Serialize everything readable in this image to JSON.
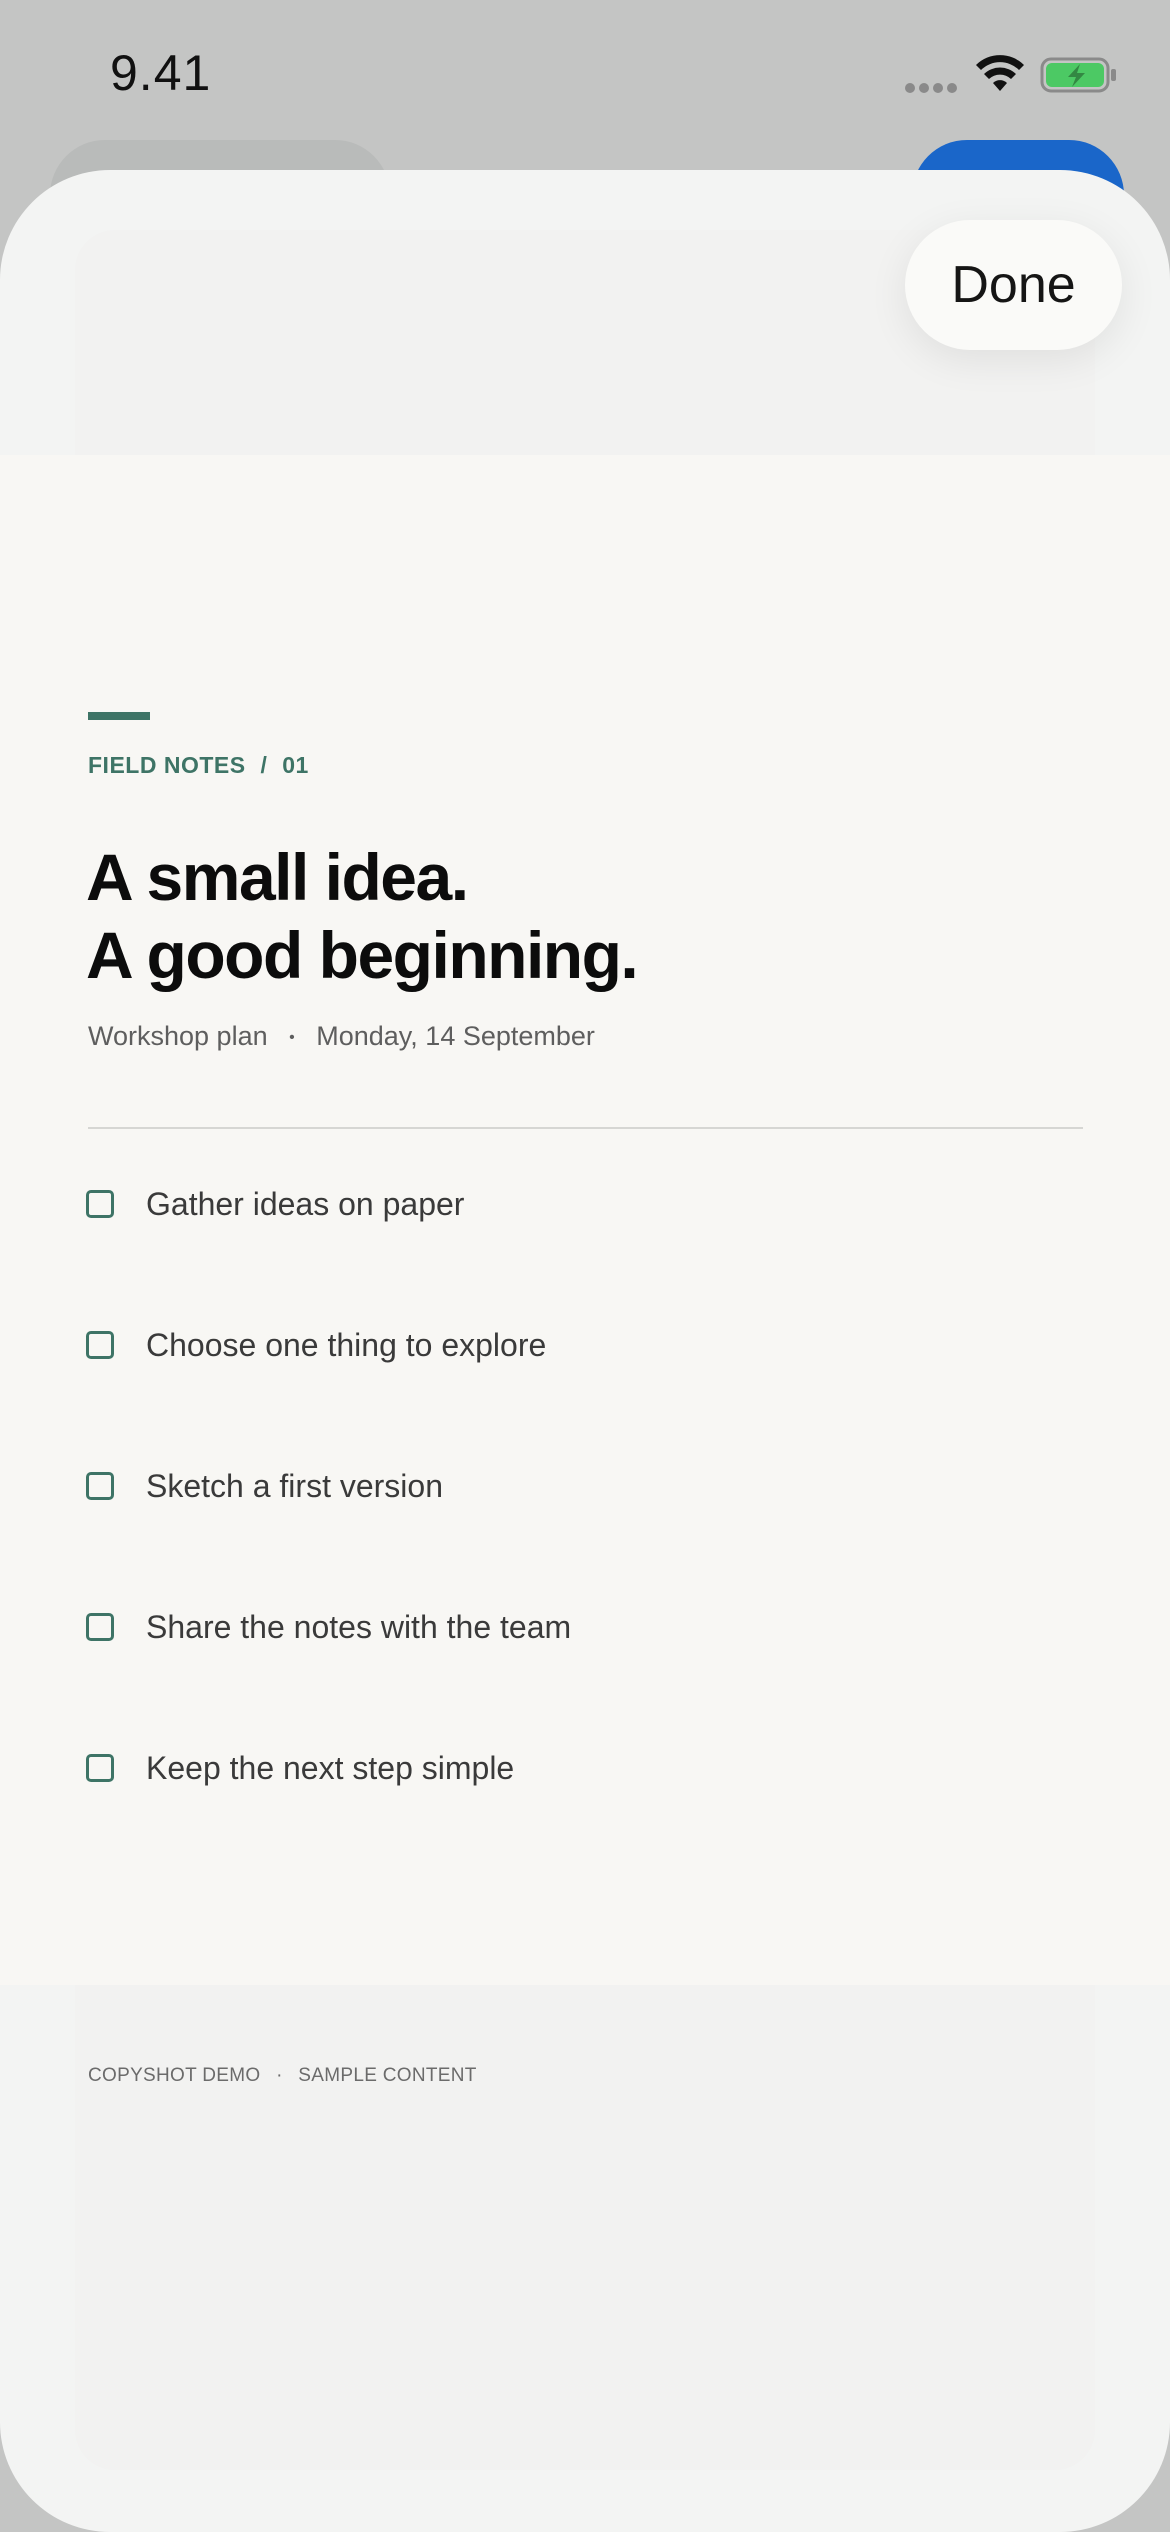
{
  "status_bar": {
    "time": "9.41",
    "battery_color": "#4cc964"
  },
  "sheet": {
    "done_label": "Done"
  },
  "note": {
    "eyebrow_left": "FIELD NOTES",
    "eyebrow_sep": "/",
    "eyebrow_right": "01",
    "headline_line1": "A small idea.",
    "headline_line2": "A good beginning.",
    "meta_left": "Workshop plan",
    "meta_dot": "•",
    "meta_right": "Monday, 14 September",
    "accent_color": "#3e7466"
  },
  "checklist": [
    {
      "label": "Gather ideas on paper",
      "checked": false
    },
    {
      "label": "Choose one thing to explore",
      "checked": false
    },
    {
      "label": "Sketch a first version",
      "checked": false
    },
    {
      "label": "Share the notes with the team",
      "checked": false
    },
    {
      "label": "Keep the next step simple",
      "checked": false
    }
  ],
  "footer": {
    "left": "COPYSHOT DEMO",
    "sep": "·",
    "right": "SAMPLE CONTENT"
  }
}
